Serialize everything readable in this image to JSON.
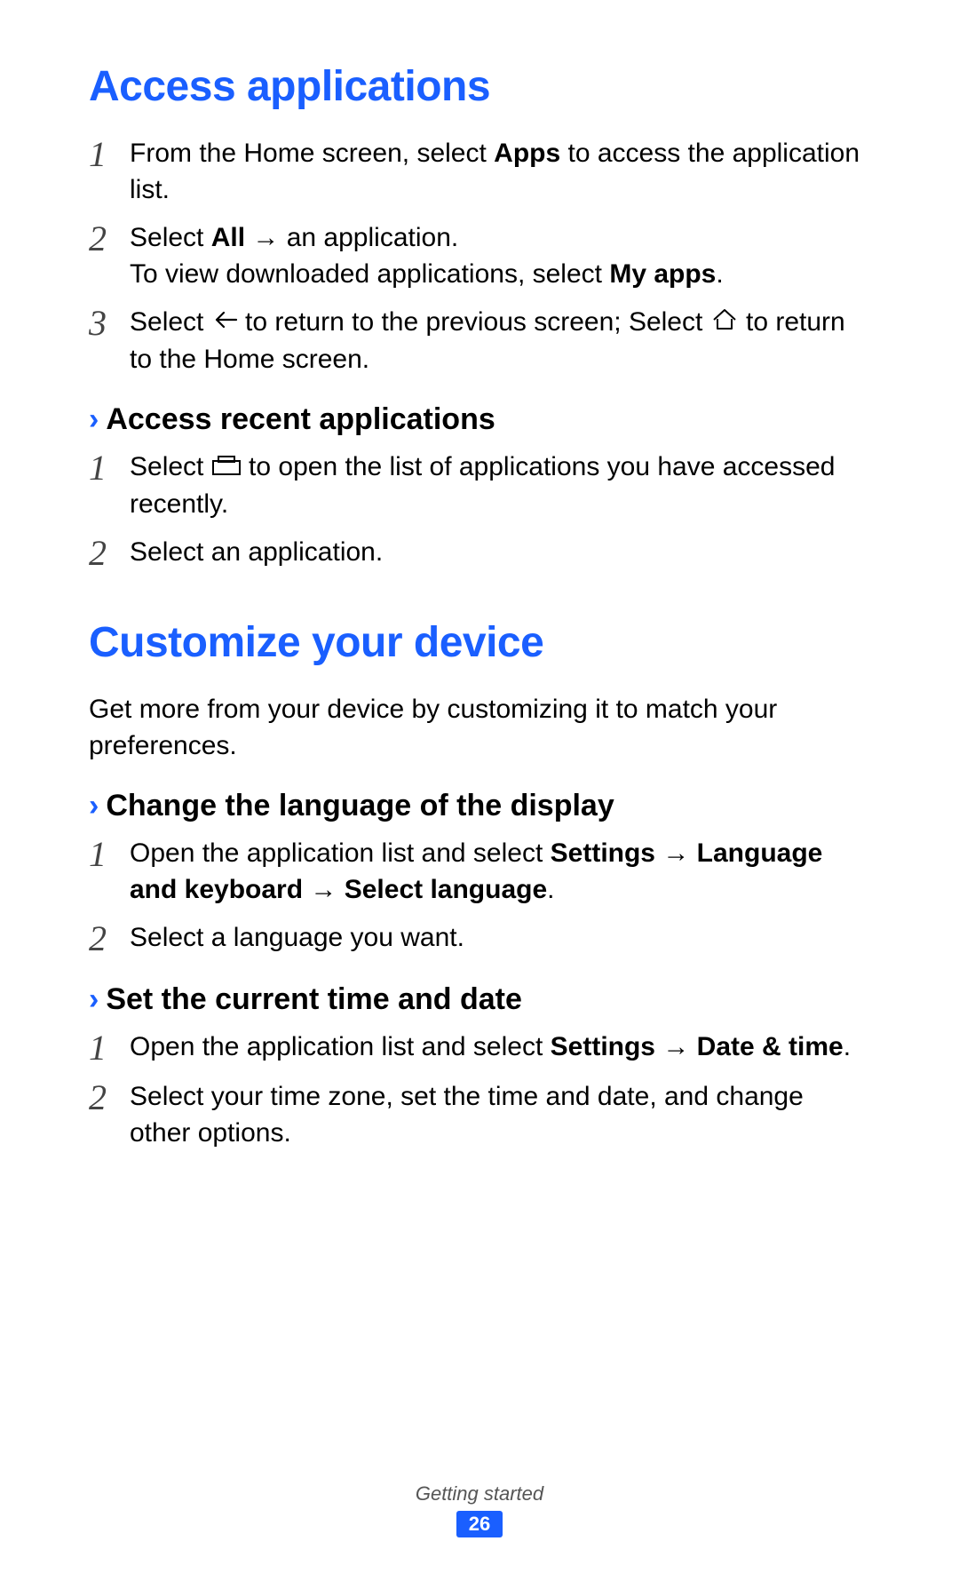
{
  "heading1": "Access applications",
  "s1_steps": {
    "0": {
      "pre": "From the Home screen, select ",
      "bold": "Apps",
      "post": " to access the application list."
    },
    "1": {
      "l1_pre": "Select ",
      "l1_bold": "All",
      "l1_post": " → an application.",
      "l2_pre": "To view downloaded applications, select ",
      "l2_bold": "My apps",
      "l2_post": "."
    },
    "2": {
      "pre": "Select ",
      "mid": " to return to the previous screen; Select ",
      "post": " to return to the Home screen."
    }
  },
  "sub1": "Access recent applications",
  "sub1_steps": {
    "0": {
      "pre": "Select ",
      "post": " to open the list of applications you have accessed recently."
    },
    "1": {
      "text": "Select an application."
    }
  },
  "heading2": "Customize your device",
  "intro2": "Get more from your device by customizing it to match your preferences.",
  "sub2": "Change the language of the display",
  "sub2_steps": {
    "0": {
      "pre": "Open the application list and select ",
      "bold": "Settings → Language and keyboard → Select language",
      "post": "."
    },
    "1": {
      "text": "Select a language you want."
    }
  },
  "sub3": "Set the current time and date",
  "sub3_steps": {
    "0": {
      "pre": "Open the application list and select ",
      "bold": "Settings → Date & time",
      "post": "."
    },
    "1": {
      "text": "Select your time zone, set the time and date, and change other options."
    }
  },
  "footer_section": "Getting started",
  "page_number": "26",
  "numbers": {
    "n1": "1",
    "n2": "2",
    "n3": "3"
  },
  "chevron": "›"
}
